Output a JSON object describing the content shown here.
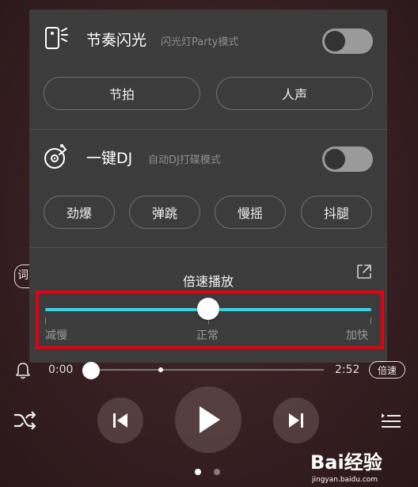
{
  "background_tag": {
    "text": "词"
  },
  "flash": {
    "title": "节奏闪光",
    "subtitle": "闪光灯Party模式",
    "toggle_on": false,
    "options": [
      {
        "label": "节拍"
      },
      {
        "label": "人声"
      }
    ]
  },
  "dj": {
    "title": "一键DJ",
    "subtitle": "自动DJ打碟模式",
    "toggle_on": false,
    "options": [
      {
        "label": "劲爆"
      },
      {
        "label": "弹跳"
      },
      {
        "label": "慢摇"
      },
      {
        "label": "抖腿"
      }
    ]
  },
  "speed": {
    "title": "倍速播放",
    "slow_label": "减慢",
    "normal_label": "正常",
    "fast_label": "加快",
    "value": 0.5
  },
  "player": {
    "current_time": "0:00",
    "total_time": "2:52",
    "speed_button": "倍速",
    "progress": 0.0
  },
  "pager": {
    "count": 2,
    "active": 0
  },
  "watermark": {
    "brand": "Bai经验",
    "url": "jingyan.baidu.com"
  },
  "colors": {
    "accent": "#28d8e8",
    "highlight": "#e60012",
    "panel": "#3c3c3c"
  }
}
